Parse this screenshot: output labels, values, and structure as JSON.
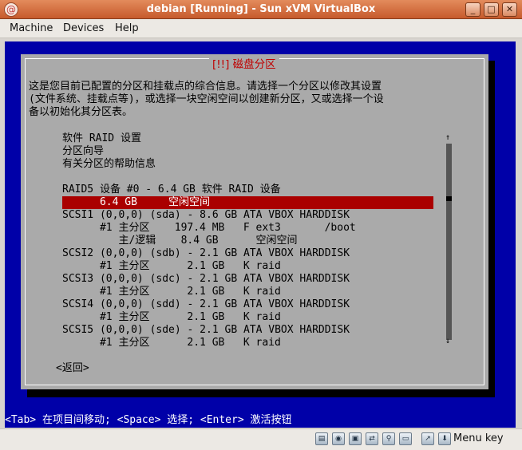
{
  "window": {
    "title": "debian [Running] - Sun xVM VirtualBox",
    "minimize": "_",
    "maximize": "□",
    "close": "✕"
  },
  "menu": {
    "machine": "Machine",
    "devices": "Devices",
    "help": "Help"
  },
  "dialog": {
    "title": "[!!] 磁盘分区",
    "desc1": "这是您目前已配置的分区和挂载点的综合信息。请选择一个分区以修改其设置",
    "desc2": "(文件系统、挂载点等)，或选择一块空闲空间以创建新分区，又或选择一个设",
    "desc3": "备以初始化其分区表。",
    "items": [
      "软件 RAID 设置",
      "分区向导",
      "有关分区的帮助信息",
      "RAID5 设备 #0 - 6.4 GB 软件 RAID 设备",
      "      6.4 GB     空闲空间",
      "SCSI1 (0,0,0) (sda) - 8.6 GB ATA VBOX HARDDISK",
      "      #1 主分区    197.4 MB   F ext3       /boot",
      "         主/逻辑    8.4 GB      空闲空间",
      "SCSI2 (0,0,0) (sdb) - 2.1 GB ATA VBOX HARDDISK",
      "      #1 主分区      2.1 GB   K raid",
      "SCSI3 (0,0,0) (sdc) - 2.1 GB ATA VBOX HARDDISK",
      "      #1 主分区      2.1 GB   K raid",
      "SCSI4 (0,0,0) (sdd) - 2.1 GB ATA VBOX HARDDISK",
      "      #1 主分区      2.1 GB   K raid",
      "SCSI5 (0,0,0) (sde) - 2.1 GB ATA VBOX HARDDISK",
      "      #1 主分区      2.1 GB   K raid"
    ],
    "back": "<返回>"
  },
  "statusline": "<Tab> 在项目间移动; <Space> 选择; <Enter> 激活按钮",
  "statusbar": {
    "host_key": "Menu key"
  }
}
